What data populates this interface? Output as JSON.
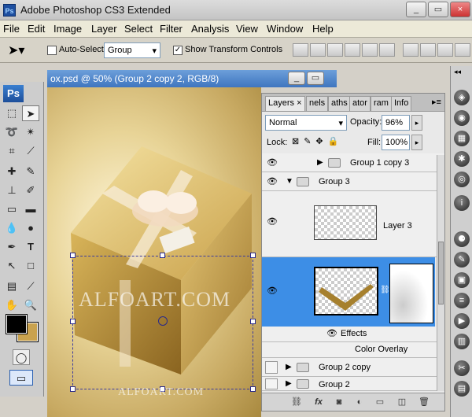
{
  "app": {
    "title": "Adobe Photoshop CS3 Extended",
    "icon": "Ps"
  },
  "window_controls": [
    "_",
    "▭",
    "×"
  ],
  "menu": [
    "File",
    "Edit",
    "Image",
    "Layer",
    "Select",
    "Filter",
    "Analysis",
    "View",
    "Window",
    "Help"
  ],
  "options": {
    "auto_select_label": "Auto-Select:",
    "auto_select_checked": false,
    "auto_select_value": "Group",
    "show_transform_label": "Show Transform Controls",
    "show_transform_checked": true
  },
  "toolbox": {
    "logo": "Ps"
  },
  "document": {
    "title": "ox.psd @ 50% (Group 2 copy 2, RGB/8)"
  },
  "watermark": {
    "large": "ALFOART.COM",
    "small": "ALFOART.COM"
  },
  "colors": {
    "foreground": "#000000",
    "background": "#c9a24e",
    "selection": "#3d8ee6"
  },
  "layers_panel": {
    "tabs": [
      "Layers",
      "nels",
      "aths",
      "ator",
      "ram",
      "Info"
    ],
    "blend_mode": "Normal",
    "opacity_label": "Opacity:",
    "opacity_value": "96%",
    "lock_label": "Lock:",
    "fill_label": "Fill:",
    "fill_value": "100%",
    "rows": {
      "group1copy3": "Group 1 copy 3",
      "group3": "Group 3",
      "layer3": "Layer 3",
      "effects": "Effects",
      "color_overlay": "Color Overlay",
      "group2copy": "Group 2 copy",
      "group2": "Group 2"
    }
  }
}
